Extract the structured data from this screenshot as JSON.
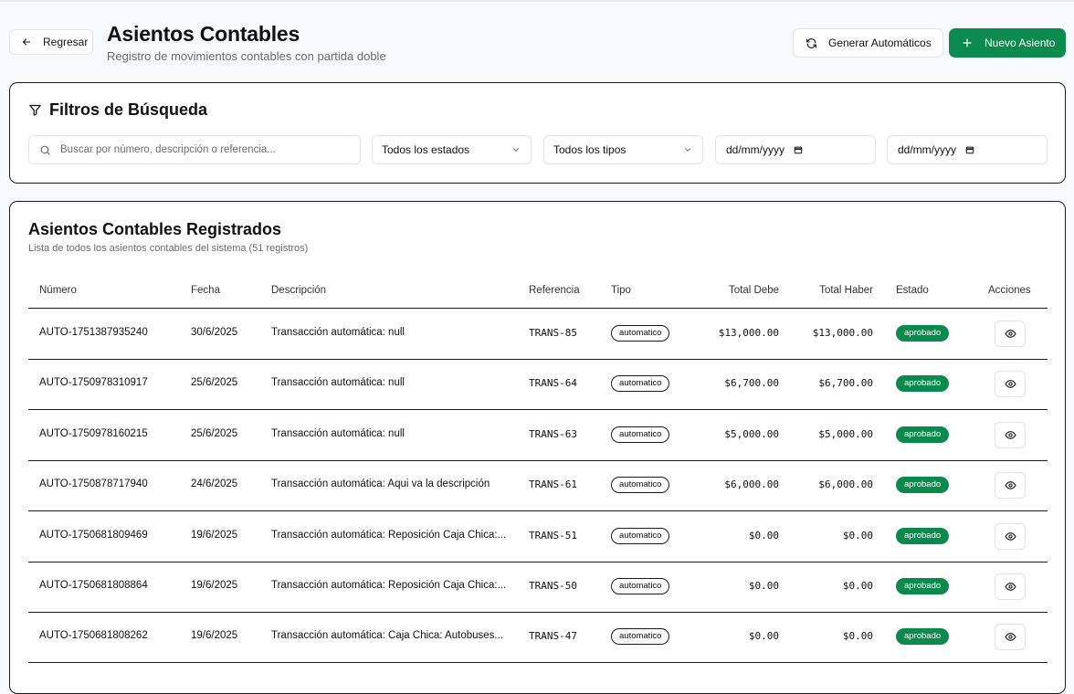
{
  "header": {
    "back_label": "Regresar",
    "title": "Asientos Contables",
    "subtitle": "Registro de movimientos contables con partida doble",
    "generate_label": "Generar Automáticos",
    "new_label": "Nuevo Asiento"
  },
  "filters": {
    "title": "Filtros de Búsqueda",
    "search_placeholder": "Buscar por número, descripción o referencia...",
    "status_select": "Todos los estados",
    "type_select": "Todos los tipos",
    "date_from": "dd/mm/yyyy",
    "date_to": "dd/mm/yyyy"
  },
  "list": {
    "title": "Asientos Contables Registrados",
    "subtitle": "Lista de todos los asientos contables del sistema (51 registros)",
    "columns": [
      "Número",
      "Fecha",
      "Descripción",
      "Referencia",
      "Tipo",
      "Total Debe",
      "Total Haber",
      "Estado",
      "Acciones"
    ],
    "rows": [
      {
        "numero": "AUTO-1751387935240",
        "fecha": "30/6/2025",
        "descripcion": "Transacción automática: null",
        "referencia": "TRANS-85",
        "tipo": "automatico",
        "debe": "$13,000.00",
        "haber": "$13,000.00",
        "estado": "aprobado"
      },
      {
        "numero": "AUTO-1750978310917",
        "fecha": "25/6/2025",
        "descripcion": "Transacción automática: null",
        "referencia": "TRANS-64",
        "tipo": "automatico",
        "debe": "$6,700.00",
        "haber": "$6,700.00",
        "estado": "aprobado"
      },
      {
        "numero": "AUTO-1750978160215",
        "fecha": "25/6/2025",
        "descripcion": "Transacción automática: null",
        "referencia": "TRANS-63",
        "tipo": "automatico",
        "debe": "$5,000.00",
        "haber": "$5,000.00",
        "estado": "aprobado"
      },
      {
        "numero": "AUTO-1750878717940",
        "fecha": "24/6/2025",
        "descripcion": "Transacción automática: Aqui va la descripción",
        "referencia": "TRANS-61",
        "tipo": "automatico",
        "debe": "$6,000.00",
        "haber": "$6,000.00",
        "estado": "aprobado"
      },
      {
        "numero": "AUTO-1750681809469",
        "fecha": "19/6/2025",
        "descripcion": "Transacción automática: Reposición Caja Chica:...",
        "referencia": "TRANS-51",
        "tipo": "automatico",
        "debe": "$0.00",
        "haber": "$0.00",
        "estado": "aprobado"
      },
      {
        "numero": "AUTO-1750681808864",
        "fecha": "19/6/2025",
        "descripcion": "Transacción automática: Reposición Caja Chica:...",
        "referencia": "TRANS-50",
        "tipo": "automatico",
        "debe": "$0.00",
        "haber": "$0.00",
        "estado": "aprobado"
      },
      {
        "numero": "AUTO-1750681808262",
        "fecha": "19/6/2025",
        "descripcion": "Transacción automática: Caja Chica: Autobuses...",
        "referencia": "TRANS-47",
        "tipo": "automatico",
        "debe": "$0.00",
        "haber": "$0.00",
        "estado": "aprobado"
      }
    ]
  },
  "colors": {
    "accent": "#0b8a4e",
    "border": "#1a1a1a",
    "muted": "#6b6b73"
  }
}
